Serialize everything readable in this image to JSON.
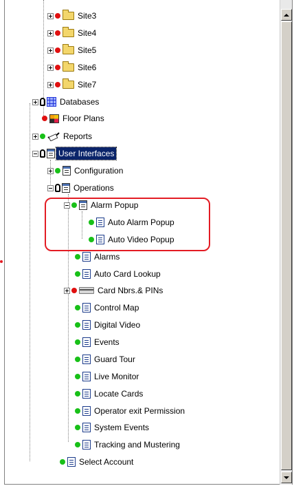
{
  "tree": {
    "sites": [
      "Site3",
      "Site4",
      "Site5",
      "Site6",
      "Site7"
    ],
    "databases": "Databases",
    "floor_plans": "Floor Plans",
    "reports": "Reports",
    "user_interfaces": "User Interfaces",
    "configuration": "Configuration",
    "operations": "Operations",
    "alarm_popup": "Alarm Popup",
    "alarm_popup_children": [
      "Auto Alarm Popup",
      "Auto Video Popup"
    ],
    "operations_children": [
      "Alarms",
      "Auto Card Lookup",
      "Card Nbrs.& PINs",
      "Control Map",
      "Digital Video",
      "Events",
      "Guard Tour",
      "Live Monitor",
      "Locate Cards",
      "Operator exit Permission",
      "System Events",
      "Tracking and Mustering"
    ],
    "select_account": "Select Account"
  },
  "colors": {
    "selection": "#0a246a",
    "highlight_box": "#e31b23",
    "status_red": "#e01010",
    "status_green": "#18c018"
  }
}
